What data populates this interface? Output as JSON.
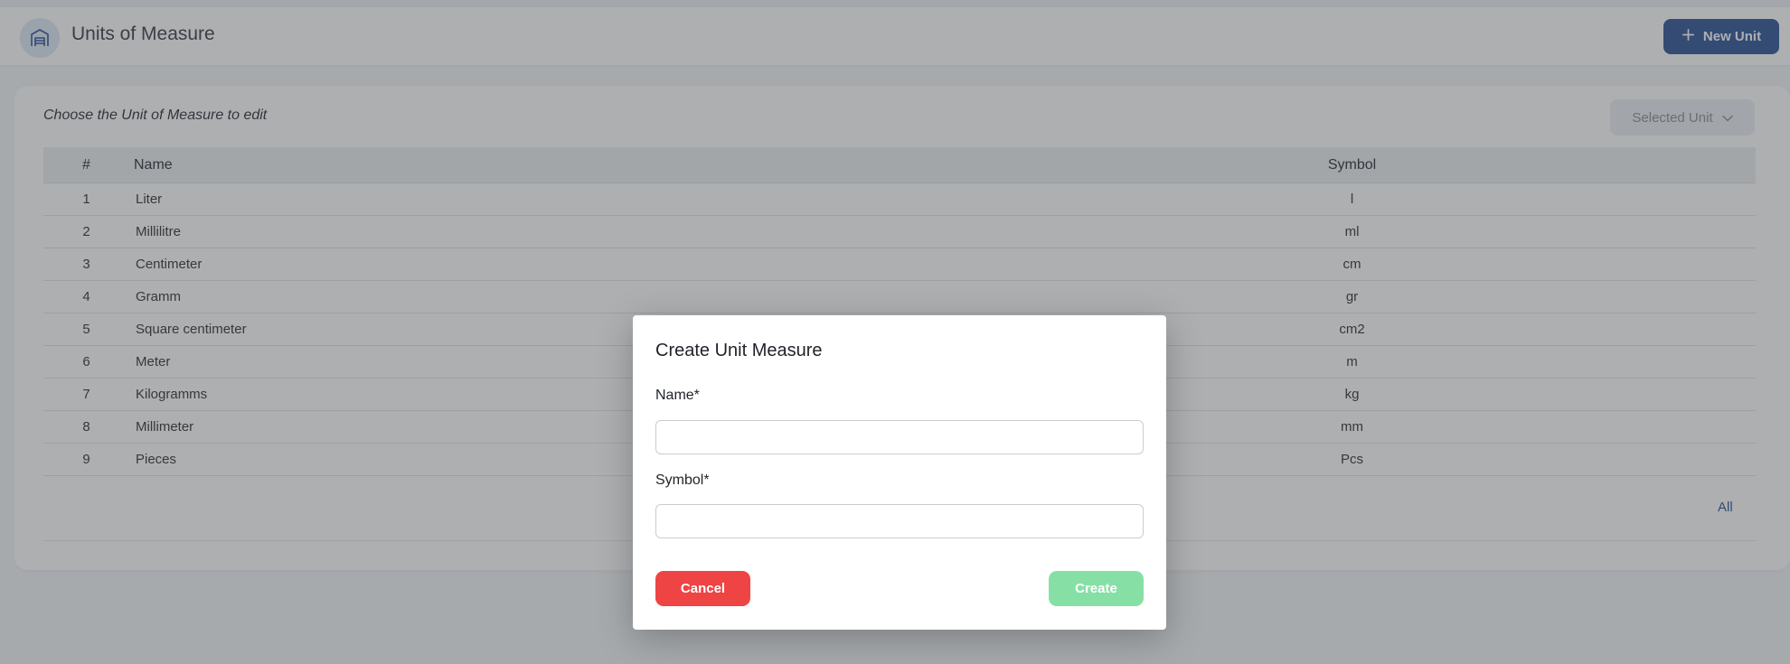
{
  "header": {
    "title": "Units of Measure",
    "logo_icon": "warehouse-icon",
    "new_button_label": "New Unit",
    "new_button_icon": "plus-icon"
  },
  "card": {
    "title": "Choose the Unit of Measure to edit",
    "select_label": "Selected Unit",
    "select_icon": "chevron-down-icon"
  },
  "table": {
    "columns": {
      "num": "#",
      "name": "Name",
      "symbol": "Symbol"
    },
    "rows": [
      {
        "num": "1",
        "name": "Liter",
        "symbol": "l"
      },
      {
        "num": "2",
        "name": "Millilitre",
        "symbol": "ml"
      },
      {
        "num": "3",
        "name": "Centimeter",
        "symbol": "cm"
      },
      {
        "num": "4",
        "name": "Gramm",
        "symbol": "gr"
      },
      {
        "num": "5",
        "name": "Square centimeter",
        "symbol": "cm2"
      },
      {
        "num": "6",
        "name": "Meter",
        "symbol": "m"
      },
      {
        "num": "7",
        "name": "Kilogramms",
        "symbol": "kg"
      },
      {
        "num": "8",
        "name": "Millimeter",
        "symbol": "mm"
      },
      {
        "num": "9",
        "name": "Pieces",
        "symbol": "Pcs"
      }
    ],
    "all_link": "All"
  },
  "modal": {
    "title": "Create Unit Measure",
    "name_label": "Name*",
    "name_value": "",
    "symbol_label": "Symbol*",
    "symbol_value": "",
    "cancel_label": "Cancel",
    "create_label": "Create"
  },
  "colors": {
    "primary": "#2f5496",
    "cancel": "#ef4444",
    "create_disabled": "#86e0a6"
  }
}
